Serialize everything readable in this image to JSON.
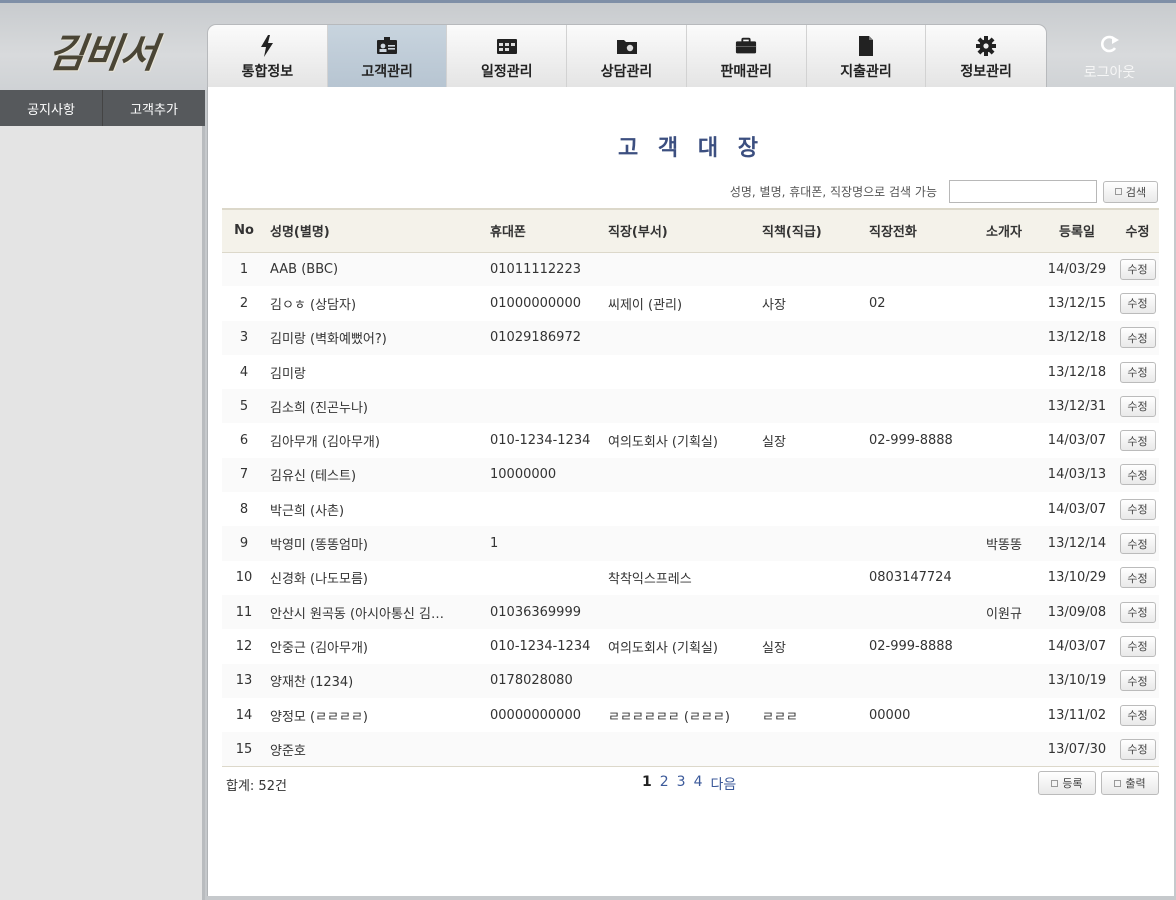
{
  "app": {
    "logo_text": "김비서"
  },
  "tabs": [
    {
      "label": "통합정보",
      "icon": "lightning-icon",
      "active": false
    },
    {
      "label": "고객관리",
      "icon": "contact-card-icon",
      "active": true
    },
    {
      "label": "일정관리",
      "icon": "calendar-icon",
      "active": false
    },
    {
      "label": "상담관리",
      "icon": "chat-folder-icon",
      "active": false
    },
    {
      "label": "판매관리",
      "icon": "briefcase-icon",
      "active": false
    },
    {
      "label": "지출관리",
      "icon": "document-icon",
      "active": false
    },
    {
      "label": "정보관리",
      "icon": "gear-icon",
      "active": false
    }
  ],
  "logout": {
    "label": "로그아웃",
    "icon": "logout-arrow-icon"
  },
  "subnav": [
    "공지사항",
    "고객추가"
  ],
  "page": {
    "title": "고 객 대 장"
  },
  "search": {
    "hint": "성명, 별명, 휴대폰, 직장명으로 검색 가능",
    "value": "",
    "button": "검색"
  },
  "table": {
    "headers": [
      "No",
      "성명(별명)",
      "휴대폰",
      "직장(부서)",
      "직책(직급)",
      "직장전화",
      "소개자",
      "등록일",
      "수정"
    ],
    "edit_label": "수정",
    "rows": [
      [
        "1",
        "AAB (BBC)",
        "01011112223",
        "",
        "",
        "",
        "",
        "14/03/29"
      ],
      [
        "2",
        "김ㅇㅎ (상담자)",
        "01000000000",
        "씨제이 (관리)",
        "사장",
        "02",
        "",
        "13/12/15"
      ],
      [
        "3",
        "김미랑 (벽화예뻤어?)",
        "01029186972",
        "",
        "",
        "",
        "",
        "13/12/18"
      ],
      [
        "4",
        "김미랑",
        "",
        "",
        "",
        "",
        "",
        "13/12/18"
      ],
      [
        "5",
        "김소희 (진곤누나)",
        "",
        "",
        "",
        "",
        "",
        "13/12/31"
      ],
      [
        "6",
        "김아무개 (김아무개)",
        "010-1234-1234",
        "여의도회사 (기획실)",
        "실장",
        "02-999-8888",
        "",
        "14/03/07"
      ],
      [
        "7",
        "김유신 (테스트)",
        "10000000",
        "",
        "",
        "",
        "",
        "14/03/13"
      ],
      [
        "8",
        "박근희 (사촌)",
        "",
        "",
        "",
        "",
        "",
        "14/03/07"
      ],
      [
        "9",
        "박영미 (똥똥엄마)",
        "1",
        "",
        "",
        "",
        "박똥똥",
        "13/12/14"
      ],
      [
        "10",
        "신경화 (나도모름)",
        "",
        "착착익스프레스",
        "",
        "0803147724",
        "",
        "13/10/29"
      ],
      [
        "11",
        "안산시 원곡동 (아시아통신 김…",
        "01036369999",
        "",
        "",
        "",
        "이원규",
        "13/09/08"
      ],
      [
        "12",
        "안중근 (김아무개)",
        "010-1234-1234",
        "여의도회사 (기획실)",
        "실장",
        "02-999-8888",
        "",
        "14/03/07"
      ],
      [
        "13",
        "양재찬 (1234)",
        "0178028080",
        "",
        "",
        "",
        "",
        "13/10/19"
      ],
      [
        "14",
        "양정모 (ㄹㄹㄹㄹ)",
        "00000000000",
        "ㄹㄹㄹㄹㄹㄹ (ㄹㄹㄹ)",
        "ㄹㄹㄹ",
        "00000",
        "",
        "13/11/02"
      ],
      [
        "15",
        "양준호",
        "",
        "",
        "",
        "",
        "",
        "13/07/30"
      ]
    ]
  },
  "footer": {
    "total": "합계: 52건",
    "pages": [
      "1",
      "2",
      "3",
      "4"
    ],
    "current_page": "1",
    "next_label": "다음",
    "register": "등록",
    "print": "출력"
  }
}
